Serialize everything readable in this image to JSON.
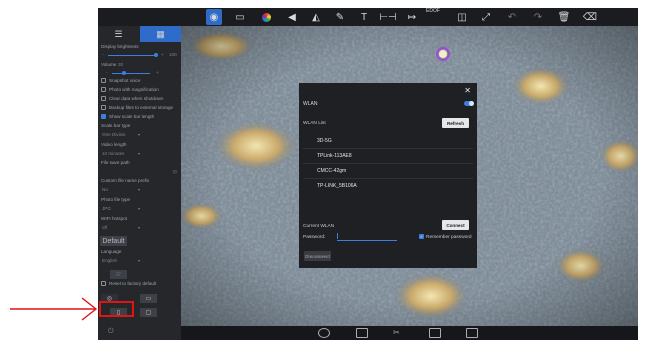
{
  "toolbar": {
    "labels": {
      "edof": "EDOF"
    },
    "icons": [
      "camera-icon",
      "crop-icon",
      "color-wheel-icon",
      "triangle-left-icon",
      "mirror-icon",
      "pen-icon",
      "text-icon",
      "measure-icon",
      "distance-icon",
      "edof-icon",
      "split-view-icon",
      "expand-icon",
      "undo-icon",
      "redo-icon",
      "delete-icon",
      "eraser-icon"
    ]
  },
  "sidebar": {
    "tabs": [
      {
        "icon": "sliders-icon"
      },
      {
        "icon": "grid-icon"
      }
    ],
    "display_brightness": "Display brightness",
    "brightness_value": "100",
    "volume": "Volume",
    "volume_value": "30",
    "snapshot_voice": "Snapshot voice",
    "photo_magnification": "Photo with magnification",
    "clear_data": "Clear data when shutdown",
    "backup_files": "Backup files to external storage",
    "show_scale_bar": "Show scale bar length",
    "scale_bar_type": "Scale bar type",
    "scale_bar_value": "One Divisio",
    "video_length": "Video length",
    "video_length_value": "10 minutes",
    "file_save_path": "File save path",
    "custom_prefix": "Custom file name prefix",
    "prefix_value": "No",
    "photo_file_type": "Photo file type",
    "photo_type_value": "JPG",
    "wifi_hotspot": "WIFI hotspot",
    "wifi_hotspot_value": "off",
    "default_btn": "Default",
    "language": "Language",
    "language_value": "English",
    "reset_factory": "Reset to factory default"
  },
  "dialog": {
    "wlan": "WLAN",
    "wlan_list": "WLAN List",
    "refresh": "Refresh",
    "networks": [
      "3D-5G",
      "TPLink-113AE8",
      "CMCC-42gm",
      "TP-LINK_5B106A"
    ],
    "current_wlan": "Current WLAN",
    "connect": "Connect",
    "password": "Password:",
    "remember_password": "Remember password",
    "disconnect": "Disconnect",
    "toggle_on": true
  },
  "colors": {
    "accent": "#3e7ee0",
    "highlight": "#e11414"
  }
}
